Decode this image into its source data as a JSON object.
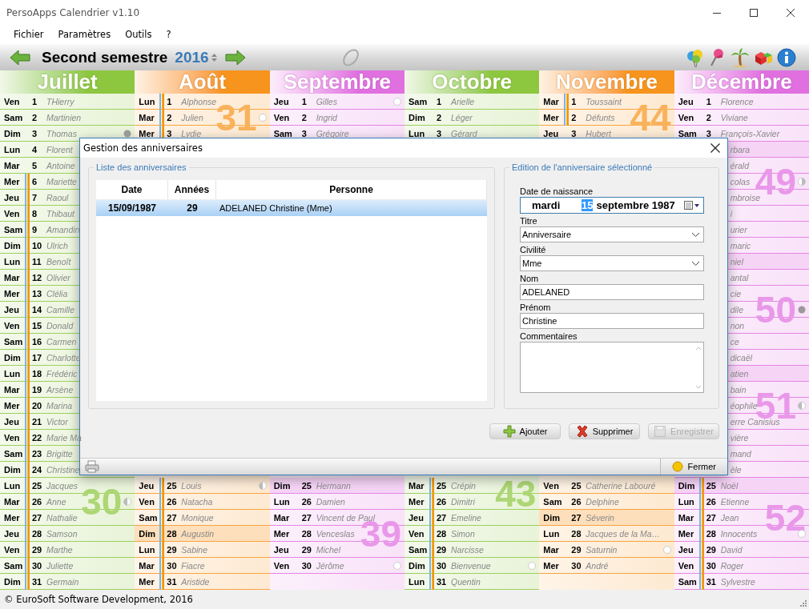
{
  "window": {
    "title": "PersoApps Calendrier v1.10"
  },
  "menu": [
    "Fichier",
    "Paramètres",
    "Outils",
    "?"
  ],
  "toolbar": {
    "period": "Second semestre",
    "year": "2016"
  },
  "months": [
    {
      "name": "Juillet",
      "color": "#8dc63f",
      "top": [
        {
          "day": "Ven",
          "num": "1",
          "name": "THierry",
          "holiday": false,
          "highlight": false
        },
        {
          "day": "Sam",
          "num": "2",
          "name": "Martinien",
          "holiday": false,
          "highlight": false
        },
        {
          "day": "Dim",
          "num": "3",
          "name": "Thomas",
          "holiday": false,
          "highlight": false,
          "full_moon": true
        }
      ],
      "middle": [
        {
          "day": "Lun",
          "num": "4",
          "name": "Florent",
          "holiday": false,
          "highlight": false
        },
        {
          "day": "Mar",
          "num": "5",
          "name": "Antoine",
          "holiday": false,
          "highlight": false
        },
        {
          "day": "Mer",
          "num": "6",
          "name": "Mariette",
          "holiday": true,
          "highlight": false
        },
        {
          "day": "Jeu",
          "num": "7",
          "name": "Raoul",
          "holiday": true,
          "highlight": false
        },
        {
          "day": "Ven",
          "num": "8",
          "name": "Thibaut",
          "holiday": true,
          "highlight": false
        },
        {
          "day": "Sam",
          "num": "9",
          "name": "Amandin",
          "holiday": true,
          "highlight": false
        },
        {
          "day": "Dim",
          "num": "10",
          "name": "Ulrich",
          "holiday": true,
          "highlight": false
        },
        {
          "day": "Lun",
          "num": "11",
          "name": "Benoît",
          "holiday": true,
          "highlight": false
        },
        {
          "day": "Mar",
          "num": "12",
          "name": "Olivier",
          "holiday": true,
          "highlight": false
        },
        {
          "day": "Mer",
          "num": "13",
          "name": "Clélia",
          "holiday": true,
          "highlight": false
        },
        {
          "day": "Jeu",
          "num": "14",
          "name": "Camille",
          "holiday": true,
          "highlight": false
        },
        {
          "day": "Ven",
          "num": "15",
          "name": "Donald",
          "holiday": true,
          "highlight": false
        },
        {
          "day": "Sam",
          "num": "16",
          "name": "Carmen",
          "holiday": true,
          "highlight": false
        },
        {
          "day": "Dim",
          "num": "17",
          "name": "Charlotte",
          "holiday": true,
          "highlight": false
        },
        {
          "day": "Lun",
          "num": "18",
          "name": "Frédéric",
          "holiday": true,
          "highlight": false
        },
        {
          "day": "Mar",
          "num": "19",
          "name": "Arsène",
          "holiday": true,
          "highlight": false
        },
        {
          "day": "Mer",
          "num": "20",
          "name": "Marina",
          "holiday": true,
          "highlight": false
        },
        {
          "day": "Jeu",
          "num": "21",
          "name": "Victor",
          "holiday": true,
          "highlight": false
        },
        {
          "day": "Ven",
          "num": "22",
          "name": "Marie Ma",
          "holiday": true,
          "highlight": false
        },
        {
          "day": "Sam",
          "num": "23",
          "name": "Brigitte",
          "holiday": true,
          "highlight": false
        },
        {
          "day": "Dim",
          "num": "24",
          "name": "Christine",
          "holiday": true,
          "highlight": false
        }
      ],
      "bottom": [
        {
          "day": "Lun",
          "num": "25",
          "name": "Jacques",
          "holiday": true,
          "highlight": false
        },
        {
          "day": "Mar",
          "num": "26",
          "name": "Anne",
          "holiday": true,
          "highlight": false,
          "last_quarter": true,
          "week": "30"
        },
        {
          "day": "Mer",
          "num": "27",
          "name": "Nathalie",
          "holiday": true,
          "highlight": false
        },
        {
          "day": "Jeu",
          "num": "28",
          "name": "Samson",
          "holiday": true,
          "highlight": false
        },
        {
          "day": "Ven",
          "num": "29",
          "name": "Marthe",
          "holiday": true,
          "highlight": false
        },
        {
          "day": "Sam",
          "num": "30",
          "name": "Juliette",
          "holiday": true,
          "highlight": false
        },
        {
          "day": "Dim",
          "num": "31",
          "name": "Germain",
          "holiday": true,
          "highlight": false
        }
      ]
    },
    {
      "name": "Août",
      "color": "#f7941d",
      "top": [
        {
          "day": "Lun",
          "num": "1",
          "name": "Alphonse",
          "holiday": true,
          "highlight": false
        },
        {
          "day": "Mar",
          "num": "2",
          "name": "Julien",
          "holiday": true,
          "highlight": false,
          "new_moon": true,
          "week": "31"
        },
        {
          "day": "Mer",
          "num": "3",
          "name": "Lydie",
          "holiday": true,
          "highlight": false
        }
      ],
      "bottom": [
        {
          "day": "Jeu",
          "num": "25",
          "name": "Louis",
          "holiday": true,
          "highlight": false,
          "last_quarter": true
        },
        {
          "day": "Ven",
          "num": "26",
          "name": "Natacha",
          "holiday": true,
          "highlight": false
        },
        {
          "day": "Sam",
          "num": "27",
          "name": "Monique",
          "holiday": true,
          "highlight": false
        },
        {
          "day": "Dim",
          "num": "28",
          "name": "Augustin",
          "holiday": true,
          "highlight": true
        },
        {
          "day": "Lun",
          "num": "29",
          "name": "Sabine",
          "holiday": true,
          "highlight": false
        },
        {
          "day": "Mar",
          "num": "30",
          "name": "Fiacre",
          "holiday": true,
          "highlight": false
        },
        {
          "day": "Mer",
          "num": "31",
          "name": "Aristide",
          "holiday": true,
          "highlight": false
        }
      ]
    },
    {
      "name": "Septembre",
      "color": "#e070e0",
      "top": [
        {
          "day": "Jeu",
          "num": "1",
          "name": "Gilles",
          "holiday": false,
          "highlight": false,
          "new_moon": true
        },
        {
          "day": "Ven",
          "num": "2",
          "name": "Ingrid",
          "holiday": false,
          "highlight": false
        },
        {
          "day": "Sam",
          "num": "3",
          "name": "Grégoire",
          "holiday": false,
          "highlight": false
        }
      ],
      "bottom": [
        {
          "day": "Dim",
          "num": "25",
          "name": "Hermann",
          "holiday": false,
          "highlight": true
        },
        {
          "day": "Lun",
          "num": "26",
          "name": "Damien",
          "holiday": false,
          "highlight": false
        },
        {
          "day": "Mar",
          "num": "27",
          "name": "Vincent de Paul",
          "holiday": false,
          "highlight": false
        },
        {
          "day": "Mer",
          "num": "28",
          "name": "Venceslas",
          "holiday": false,
          "highlight": false,
          "week": "39"
        },
        {
          "day": "Jeu",
          "num": "29",
          "name": "Michel",
          "holiday": false,
          "highlight": false
        },
        {
          "day": "Ven",
          "num": "30",
          "name": "Jérôme",
          "holiday": false,
          "highlight": false,
          "new_moon": true
        }
      ]
    },
    {
      "name": "Octobre",
      "color": "#8dc63f",
      "top": [
        {
          "day": "Sam",
          "num": "1",
          "name": "Arielle",
          "holiday": false,
          "highlight": false
        },
        {
          "day": "Dim",
          "num": "2",
          "name": "Léger",
          "holiday": false,
          "highlight": false
        },
        {
          "day": "Lun",
          "num": "3",
          "name": "Gérard",
          "holiday": false,
          "highlight": false
        }
      ],
      "bottom": [
        {
          "day": "Mar",
          "num": "25",
          "name": "Crépin",
          "holiday": true,
          "highlight": false,
          "week": "43"
        },
        {
          "day": "Mer",
          "num": "26",
          "name": "Dimitri",
          "holiday": true,
          "highlight": false
        },
        {
          "day": "Jeu",
          "num": "27",
          "name": "Emeline",
          "holiday": true,
          "highlight": false
        },
        {
          "day": "Ven",
          "num": "28",
          "name": "Simon",
          "holiday": true,
          "highlight": false
        },
        {
          "day": "Sam",
          "num": "29",
          "name": "Narcisse",
          "holiday": true,
          "highlight": false
        },
        {
          "day": "Dim",
          "num": "30",
          "name": "Bienvenue",
          "holiday": true,
          "highlight": false,
          "new_moon": true
        },
        {
          "day": "Lun",
          "num": "31",
          "name": "Quentin",
          "holiday": true,
          "highlight": false
        }
      ]
    },
    {
      "name": "Novembre",
      "color": "#f7941d",
      "top": [
        {
          "day": "Mar",
          "num": "1",
          "name": "Toussaint",
          "holiday": true,
          "highlight": false
        },
        {
          "day": "Mer",
          "num": "2",
          "name": "Défunts",
          "holiday": true,
          "highlight": false,
          "week": "44"
        },
        {
          "day": "Jeu",
          "num": "3",
          "name": "Hubert",
          "holiday": false,
          "highlight": false
        }
      ],
      "bottom": [
        {
          "day": "Ven",
          "num": "25",
          "name": "Catherine Labouré",
          "holiday": false,
          "highlight": false
        },
        {
          "day": "Sam",
          "num": "26",
          "name": "Delphine",
          "holiday": false,
          "highlight": false
        },
        {
          "day": "Dim",
          "num": "27",
          "name": "Séverin",
          "holiday": false,
          "highlight": true
        },
        {
          "day": "Lun",
          "num": "28",
          "name": "Jacques de la Ma…",
          "holiday": false,
          "highlight": false
        },
        {
          "day": "Mar",
          "num": "29",
          "name": "Saturnin",
          "holiday": false,
          "highlight": false,
          "new_moon": true
        },
        {
          "day": "Mer",
          "num": "30",
          "name": "André",
          "holiday": false,
          "highlight": false
        }
      ]
    },
    {
      "name": "Décembre",
      "color": "#e070e0",
      "top": [
        {
          "day": "Jeu",
          "num": "1",
          "name": "Florence",
          "holiday": false,
          "highlight": false
        },
        {
          "day": "Ven",
          "num": "2",
          "name": "Viviane",
          "holiday": false,
          "highlight": false
        },
        {
          "day": "Sam",
          "num": "3",
          "name": "François-Xavier",
          "holiday": false,
          "highlight": false
        }
      ],
      "middle": [
        {
          "name": "rbara",
          "highlight": true
        },
        {
          "name": "érald",
          "highlight": false
        },
        {
          "name": "colas",
          "highlight": false,
          "first_quarter": true,
          "week": "49"
        },
        {
          "name": "mbroise",
          "highlight": false
        },
        {
          "name": "i",
          "highlight": false
        },
        {
          "name": "urier",
          "highlight": false
        },
        {
          "name": "maric",
          "highlight": false
        },
        {
          "name": "niel",
          "highlight": true
        },
        {
          "name": "antal",
          "highlight": false
        },
        {
          "name": "cie",
          "highlight": false
        },
        {
          "name": "dile",
          "highlight": false,
          "full_moon": true,
          "week": "50"
        },
        {
          "name": "non",
          "highlight": false
        },
        {
          "name": "ce",
          "highlight": false
        },
        {
          "name": "dicaël",
          "highlight": false
        },
        {
          "name": "atien",
          "highlight": true
        },
        {
          "name": "bain",
          "highlight": false
        },
        {
          "name": "éophile",
          "highlight": false,
          "last_quarter": true,
          "week": "51"
        },
        {
          "name": "erre Canisius",
          "highlight": false
        },
        {
          "name": "vière",
          "highlight": false
        },
        {
          "name": "mand",
          "highlight": false
        },
        {
          "name": "èle",
          "highlight": false
        }
      ],
      "bottom": [
        {
          "day": "Dim",
          "num": "25",
          "name": "Noël",
          "holiday": true,
          "highlight": true
        },
        {
          "day": "Lun",
          "num": "26",
          "name": "Etienne",
          "holiday": true,
          "highlight": false
        },
        {
          "day": "Mar",
          "num": "27",
          "name": "Jean",
          "holiday": true,
          "highlight": false,
          "week": "52"
        },
        {
          "day": "Mer",
          "num": "28",
          "name": "Innocents",
          "holiday": true,
          "highlight": false,
          "new_moon": true
        },
        {
          "day": "Jeu",
          "num": "29",
          "name": "David",
          "holiday": true,
          "highlight": false
        },
        {
          "day": "Ven",
          "num": "30",
          "name": "Roger",
          "holiday": true,
          "highlight": false
        },
        {
          "day": "Sam",
          "num": "31",
          "name": "Sylvestre",
          "holiday": true,
          "highlight": false
        }
      ]
    }
  ],
  "dialog": {
    "title": "Gestion des anniversaires",
    "list": {
      "legend": "Liste des anniversaires",
      "columns": [
        "Date",
        "Années",
        "Personne"
      ],
      "rows": [
        {
          "cells": [
            "15/09/1987",
            "29",
            "ADELANED Christine (Mme)"
          ],
          "selected": true
        }
      ]
    },
    "editor": {
      "legend": "Edition de l'anniversaire sélectionné",
      "fields": [
        {
          "kind": "date",
          "label": "Date de naissance",
          "weekday": "mardi",
          "day": "15",
          "month_year": "septembre 1987",
          "day_selected": true
        },
        {
          "kind": "select",
          "label": "Titre",
          "value": "Anniversaire"
        },
        {
          "kind": "select",
          "label": "Civilité",
          "value": "Mme"
        },
        {
          "kind": "text",
          "label": "Nom",
          "value": "ADELANED"
        },
        {
          "kind": "text",
          "label": "Prénom",
          "value": "Christine"
        },
        {
          "kind": "textarea",
          "label": "Commentaires"
        }
      ]
    },
    "buttons": [
      {
        "kind": "add",
        "label": "Ajouter",
        "disabled": false
      },
      {
        "kind": "delete",
        "label": "Supprimer",
        "disabled": false
      },
      {
        "kind": "save",
        "label": "Enregistrer",
        "disabled": true
      }
    ],
    "close_label": "Fermer"
  },
  "status_bar": "© EuroSoft Software Development, 2016"
}
